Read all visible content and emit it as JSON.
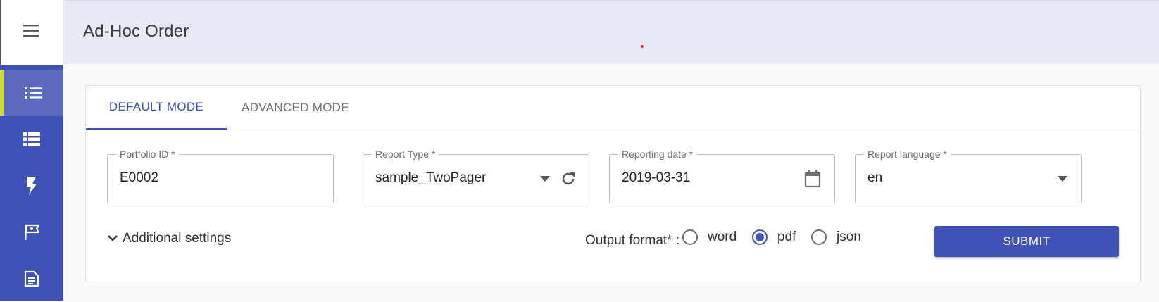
{
  "app": {
    "menu_icon": "hamburger-menu-icon",
    "accent": "#3f51b5",
    "active_indicator": "#cddc39"
  },
  "header": {
    "title": "Ad-Hoc Order"
  },
  "sidebar": {
    "items": [
      {
        "icon": "list-icon",
        "active": true
      },
      {
        "icon": "table-list-icon",
        "active": false
      },
      {
        "icon": "lightning-icon",
        "active": false
      },
      {
        "icon": "flag-icon",
        "active": false
      },
      {
        "icon": "document-icon",
        "active": false
      }
    ]
  },
  "tabs": [
    {
      "label": "DEFAULT MODE",
      "active": true
    },
    {
      "label": "ADVANCED MODE",
      "active": false
    }
  ],
  "form": {
    "portfolio": {
      "label": "Portfolio ID *",
      "value": "E0002"
    },
    "report_type": {
      "label": "Report Type *",
      "value": "sample_TwoPager",
      "icons": [
        "dropdown-arrow-icon",
        "refresh-icon"
      ]
    },
    "reporting_date": {
      "label": "Reporting date *",
      "value": "2019-03-31",
      "icon": "calendar-icon"
    },
    "report_language": {
      "label": "Report language *",
      "value": "en",
      "icon": "dropdown-arrow-icon"
    }
  },
  "additional_settings": {
    "label": "Additional settings",
    "icon": "chevron-down-icon"
  },
  "output_format": {
    "label": "Output format* :",
    "options": [
      {
        "label": "word",
        "selected": false
      },
      {
        "label": "pdf",
        "selected": true
      },
      {
        "label": "json",
        "selected": false
      }
    ]
  },
  "submit": {
    "label": "SUBMIT"
  }
}
